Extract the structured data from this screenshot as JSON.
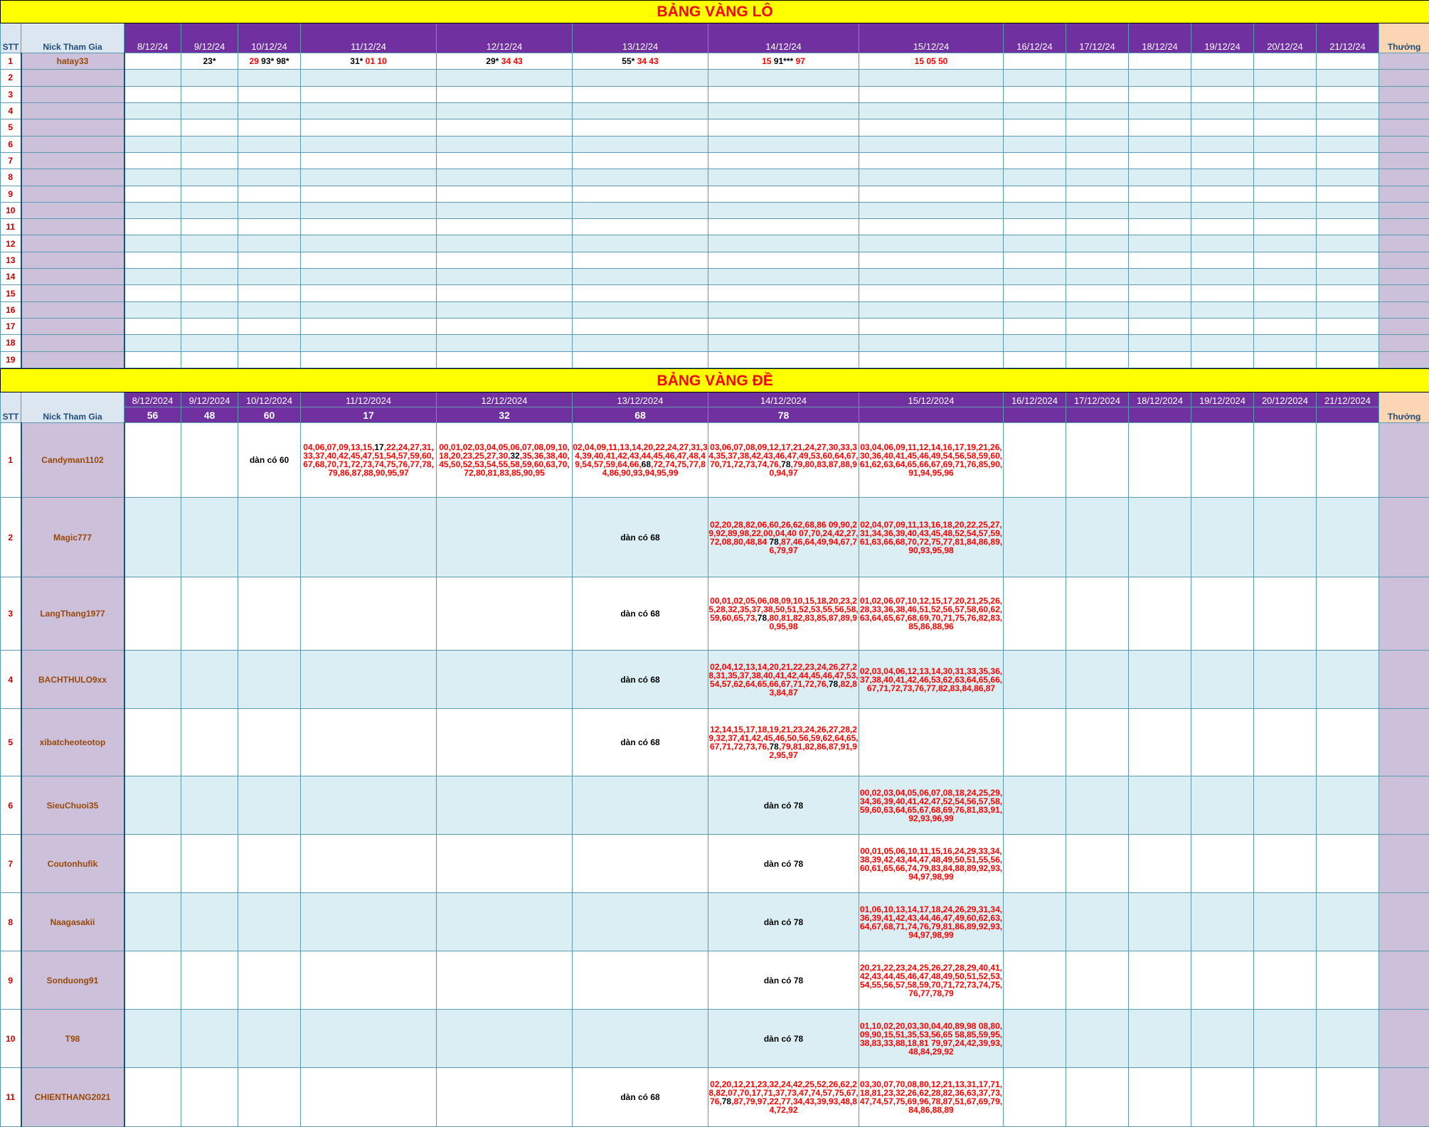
{
  "lo": {
    "title": "BẢNG VÀNG LÔ",
    "stt_header": "STT",
    "nick_header": "Nick Tham Gia",
    "thuong_header": "Thưởng",
    "dates": [
      "8/12/24",
      "9/12/24",
      "10/12/24",
      "11/12/24",
      "12/12/24",
      "13/12/24",
      "14/12/24",
      "15/12/24",
      "16/12/24",
      "17/12/24",
      "18/12/24",
      "19/12/24",
      "20/12/24",
      "21/12/24"
    ],
    "rows": [
      {
        "stt": "1",
        "nick": "hatay33",
        "cells": [
          [],
          [
            {
              "t": "23*",
              "c": "k"
            }
          ],
          [
            {
              "t": "29 ",
              "c": "r"
            },
            {
              "t": "93* 98*",
              "c": "k"
            }
          ],
          [
            {
              "t": "31* ",
              "c": "k"
            },
            {
              "t": "01 10",
              "c": "r"
            }
          ],
          [
            {
              "t": "29* ",
              "c": "k"
            },
            {
              "t": "34 43",
              "c": "r"
            }
          ],
          [
            {
              "t": "55* ",
              "c": "k"
            },
            {
              "t": "34 43",
              "c": "r"
            }
          ],
          [
            {
              "t": "15 ",
              "c": "r"
            },
            {
              "t": "91*** ",
              "c": "k"
            },
            {
              "t": "97",
              "c": "r"
            }
          ],
          [
            {
              "t": "15 05 50",
              "c": "r"
            }
          ],
          [],
          [],
          [],
          [],
          [],
          []
        ]
      },
      {
        "stt": "2",
        "nick": "",
        "cells": []
      },
      {
        "stt": "3",
        "nick": "",
        "cells": []
      },
      {
        "stt": "4",
        "nick": "",
        "cells": []
      },
      {
        "stt": "5",
        "nick": "",
        "cells": []
      },
      {
        "stt": "6",
        "nick": "",
        "cells": []
      },
      {
        "stt": "7",
        "nick": "",
        "cells": []
      },
      {
        "stt": "8",
        "nick": "",
        "cells": []
      },
      {
        "stt": "9",
        "nick": "",
        "cells": []
      },
      {
        "stt": "10",
        "nick": "",
        "cells": []
      },
      {
        "stt": "11",
        "nick": "",
        "cells": []
      },
      {
        "stt": "12",
        "nick": "",
        "cells": []
      },
      {
        "stt": "13",
        "nick": "",
        "cells": []
      },
      {
        "stt": "14",
        "nick": "",
        "cells": []
      },
      {
        "stt": "15",
        "nick": "",
        "cells": []
      },
      {
        "stt": "16",
        "nick": "",
        "cells": []
      },
      {
        "stt": "17",
        "nick": "",
        "cells": []
      },
      {
        "stt": "18",
        "nick": "",
        "cells": []
      },
      {
        "stt": "19",
        "nick": "",
        "cells": []
      }
    ]
  },
  "de": {
    "title": "BẢNG VÀNG ĐỀ",
    "stt_header": "STT",
    "nick_header": "Nick Tham Gia",
    "thuong_header": "Thưởng",
    "dates": [
      "8/12/2024",
      "9/12/2024",
      "10/12/2024",
      "11/12/2024",
      "12/12/2024",
      "13/12/2024",
      "14/12/2024",
      "15/12/2024",
      "16/12/2024",
      "17/12/2024",
      "18/12/2024",
      "19/12/2024",
      "20/12/2024",
      "21/12/2024"
    ],
    "results": [
      "56",
      "48",
      "60",
      "17",
      "32",
      "68",
      "78",
      "",
      "",
      "",
      "",
      "",
      "",
      ""
    ],
    "rows": [
      {
        "stt": "1",
        "nick": "Candyman1102",
        "cells": [
          [],
          [],
          [
            {
              "t": "dàn có 60",
              "c": "d"
            }
          ],
          [
            {
              "t": "04,06,07,09,13,15,",
              "c": "r"
            },
            {
              "t": "17",
              "c": "k"
            },
            {
              "t": ",22,24,27,31,33,37,40,42,45,47,51,54,57,59,60,67,68,70,71,72,73,74,75,76,77,78,79,86,87,88,90,95,97",
              "c": "r"
            }
          ],
          [
            {
              "t": "00,01,02,03,04,05,06,07,08,09,10,18,20,23,25,27,30,",
              "c": "r"
            },
            {
              "t": "32",
              "c": "k"
            },
            {
              "t": ",35,36,38,40,45,50,52,53,54,55,58,59,60,63,70,72,80,81,83,85,90,95",
              "c": "r"
            }
          ],
          [
            {
              "t": "02,04,09,11,13,14,20,22,24,27,31,34,39,40,41,42,43,44,45,46,47,48,49,54,57,59,64,66,",
              "c": "r"
            },
            {
              "t": "68",
              "c": "k"
            },
            {
              "t": ",72,74,75,77,84,86,90,93,94,95,99",
              "c": "r"
            }
          ],
          [
            {
              "t": "03,06,07,08,09,12,17,21,24,27,30,33,34,35,37,38,42,43,46,47,49,53,60,64,67,70,71,72,73,74,76,",
              "c": "r"
            },
            {
              "t": "78",
              "c": "k"
            },
            {
              "t": ",79,80,83,87,88,90,94,97",
              "c": "r"
            }
          ],
          [
            {
              "t": "03,04,06,09,11,12,14,16,17,19,21,26,30,36,40,41,45,46,49,54,56,58,59,60,61,62,63,64,65,66,67,69,71,76,85,90,91,94,95,96",
              "c": "r"
            }
          ],
          [],
          [],
          [],
          [],
          [],
          []
        ]
      },
      {
        "stt": "2",
        "nick": "Magic777",
        "cells": [
          [],
          [],
          [],
          [],
          [],
          [
            {
              "t": "dàn có 68",
              "c": "d"
            }
          ],
          [
            {
              "t": "02,20,28,82,06,60,26,62,68,86 09,90,29,92,89,98,22,00,04,40 07,70,24,42,27,72,08,80,48,84 ",
              "c": "r"
            },
            {
              "t": "78",
              "c": "k"
            },
            {
              "t": ",87,46,64,49,94,67,76,79,97",
              "c": "r"
            }
          ],
          [
            {
              "t": "02,04,07,09,11,13,16,18,20,22,25,27,31,34,36,39,40,43,45,48,52,54,57,59,61,63,66,68,70,72,75,77,81,84,86,89,90,93,95,98",
              "c": "r"
            }
          ],
          [],
          [],
          [],
          [],
          [],
          []
        ]
      },
      {
        "stt": "3",
        "nick": "LangThang1977",
        "cells": [
          [],
          [],
          [],
          [],
          [],
          [
            {
              "t": "dàn có 68",
              "c": "d"
            }
          ],
          [
            {
              "t": "00,01,02,05,06,08,09,10,15,18,20,23,25,28,32,35,37,38,50,51,52,53,55,56,58,59,60,65,73,",
              "c": "r"
            },
            {
              "t": "78",
              "c": "k"
            },
            {
              "t": ",80,81,82,83,85,87,89,90,95,98",
              "c": "r"
            }
          ],
          [
            {
              "t": "01,02,06,07,10,12,15,17,20,21,25,26,28,33,36,38,46,51,52,56,57,58,60,62,63,64,65,67,68,69,70,71,75,76,82,83,85,86,88,96",
              "c": "r"
            }
          ],
          [],
          [],
          [],
          [],
          [],
          []
        ]
      },
      {
        "stt": "4",
        "nick": "BACHTHULO9xx",
        "cells": [
          [],
          [],
          [],
          [],
          [],
          [
            {
              "t": "dàn có 68",
              "c": "d"
            }
          ],
          [
            {
              "t": "02,04,12,13,14,20,21,22,23,24,26,27,28,31,35,37,38,40,41,42,44,45,46,47,53,54,57,62,64,65,66,67,71,72,76,",
              "c": "r"
            },
            {
              "t": "78",
              "c": "k"
            },
            {
              "t": ",82,83,84,87",
              "c": "r"
            }
          ],
          [
            {
              "t": "02,03,04,06,12,13,14,30,31,33,35,36,37,38,40,41,42,46,53,62,63,64,65,66,67,71,72,73,76,77,82,83,84,86,87",
              "c": "r"
            }
          ],
          [],
          [],
          [],
          [],
          [],
          []
        ]
      },
      {
        "stt": "5",
        "nick": "xibatcheoteotop",
        "cells": [
          [],
          [],
          [],
          [],
          [],
          [
            {
              "t": "dàn có 68",
              "c": "d"
            }
          ],
          [
            {
              "t": "12,14,15,17,18,19,21,23,24,26,27,28,29,32,37,41,42,45,46,50,56,59,62,64,65,67,71,72,73,76,",
              "c": "r"
            },
            {
              "t": "78",
              "c": "k"
            },
            {
              "t": ",79,81,82,86,87,91,92,95,97",
              "c": "r"
            }
          ],
          [],
          [],
          [],
          [],
          [],
          [],
          []
        ]
      },
      {
        "stt": "6",
        "nick": "SieuChuoi35",
        "cells": [
          [],
          [],
          [],
          [],
          [],
          [],
          [
            {
              "t": "dàn có 78",
              "c": "d"
            }
          ],
          [
            {
              "t": "00,02,03,04,05,06,07,08,18,24,25,29,34,36,39,40,41,42,47,52,54,56,57,58,59,60,63,64,65,67,68,69,76,81,83,91,92,93,96,99",
              "c": "r"
            }
          ],
          [],
          [],
          [],
          [],
          [],
          []
        ]
      },
      {
        "stt": "7",
        "nick": "Coutonhufik",
        "cells": [
          [],
          [],
          [],
          [],
          [],
          [],
          [
            {
              "t": "dàn có 78",
              "c": "d"
            }
          ],
          [
            {
              "t": "00,01,05,06,10,11,15,16,24,29,33,34,38,39,42,43,44,47,48,49,50,51,55,56,60,61,65,66,74,79,83,84,88,89,92,93,94,97,98,99",
              "c": "r"
            }
          ],
          [],
          [],
          [],
          [],
          [],
          []
        ]
      },
      {
        "stt": "8",
        "nick": "Naagasakii",
        "cells": [
          [],
          [],
          [],
          [],
          [],
          [],
          [
            {
              "t": "dàn có 78",
              "c": "d"
            }
          ],
          [
            {
              "t": "01,06,10,13,14,17,18,24,26,29,31,34,36,39,41,42,43,44,46,47,49,60,62,63,64,67,68,71,74,76,79,81,86,89,92,93,94,97,98,99",
              "c": "r"
            }
          ],
          [],
          [],
          [],
          [],
          [],
          []
        ]
      },
      {
        "stt": "9",
        "nick": "Sonduong91",
        "cells": [
          [],
          [],
          [],
          [],
          [],
          [],
          [
            {
              "t": "dàn có 78",
              "c": "d"
            }
          ],
          [
            {
              "t": "20,21,22,23,24,25,26,27,28,29,40,41,42,43,44,45,46,47,48,49,50,51,52,53,54,55,56,57,58,59,70,71,72,73,74,75,76,77,78,79",
              "c": "r"
            }
          ],
          [],
          [],
          [],
          [],
          [],
          []
        ]
      },
      {
        "stt": "10",
        "nick": "T98",
        "cells": [
          [],
          [],
          [],
          [],
          [],
          [],
          [
            {
              "t": "dàn có 78",
              "c": "d"
            }
          ],
          [
            {
              "t": "01,10,02,20,03,30,04,40,89,98 08,80,09,90,15,51,35,53,56,65 58,85,59,95,38,83,33,88,18,81 79,97,24,42,39,93,48,84,29,92",
              "c": "r"
            }
          ],
          [],
          [],
          [],
          [],
          [],
          []
        ]
      },
      {
        "stt": "11",
        "nick": "CHIENTHANG2021",
        "cells": [
          [],
          [],
          [],
          [],
          [],
          [
            {
              "t": "dàn có 68",
              "c": "d"
            }
          ],
          [
            {
              "t": "02,20,12,21,23,32,24,42,25,52,26,62,28,82,07,70,17,71,37,73,47,74,57,75,67,76,",
              "c": "r"
            },
            {
              "t": "78",
              "c": "k"
            },
            {
              "t": ",87,79,97,22,77,34,43,39,93,48,84,72,92",
              "c": "r"
            }
          ],
          [
            {
              "t": "03,30,07,70,08,80,12,21,13,31,17,71,18,81,23,32,26,62,28,82,36,63,37,73,47,74,57,75,69,96,78,87,51,67,69,79,84,86,88,89",
              "c": "r"
            }
          ],
          [],
          [],
          [],
          [],
          [],
          []
        ]
      }
    ]
  }
}
